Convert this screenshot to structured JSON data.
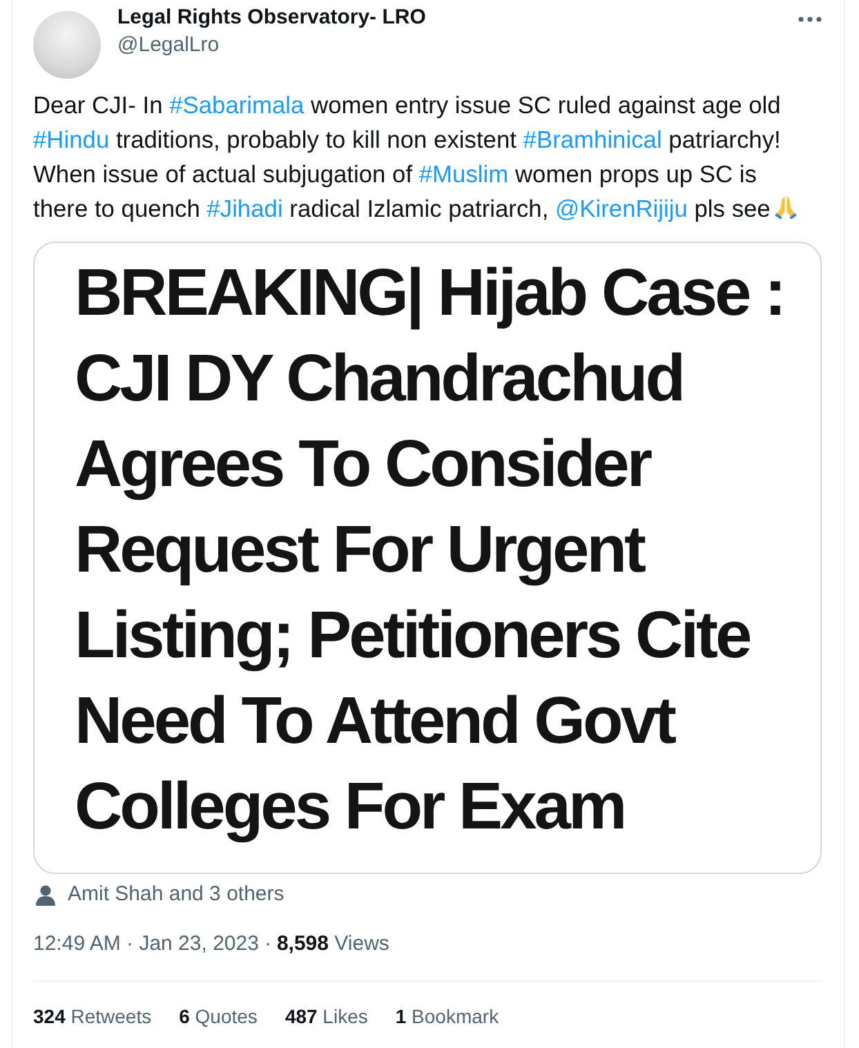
{
  "author": {
    "name": "Legal Rights Observatory- LRO",
    "handle": "@LegalLro"
  },
  "tweet_text": [
    {
      "kind": "text",
      "text": "Dear CJI- In "
    },
    {
      "kind": "hashtag",
      "text": "#Sabarimala"
    },
    {
      "kind": "text",
      "text": " women entry issue SC ruled against age old "
    },
    {
      "kind": "hashtag",
      "text": "#Hindu"
    },
    {
      "kind": "text",
      "text": " traditions, probably to kill non existent "
    },
    {
      "kind": "hashtag",
      "text": "#Bramhinical"
    },
    {
      "kind": "text",
      "text": " patriarchy! When issue of actual subjugation of "
    },
    {
      "kind": "hashtag",
      "text": "#Muslim"
    },
    {
      "kind": "text",
      "text": " women props up SC is there to quench "
    },
    {
      "kind": "hashtag",
      "text": "#Jihadi"
    },
    {
      "kind": "text",
      "text": " radical Izlamic patriarch, "
    },
    {
      "kind": "mention",
      "text": "@KirenRijiju"
    },
    {
      "kind": "text",
      "text": " pls see"
    }
  ],
  "media_card": {
    "headline": "BREAKING| Hijab Case :\nCJI DY Chandrachud\nAgrees To Consider\nRequest For Urgent\nListing; Petitioners Cite\nNeed To Attend Govt\nColleges For Exam"
  },
  "social_context": {
    "text": "Amit Shah and 3 others"
  },
  "meta": {
    "timestamp": "12:49 AM · Jan 23, 2023",
    "separator": "·",
    "views": "**8,598** Views"
  },
  "stats": [
    "**324** Retweets",
    "**6** Quotes",
    "**487** Likes",
    "**1** Bookmark"
  ]
}
